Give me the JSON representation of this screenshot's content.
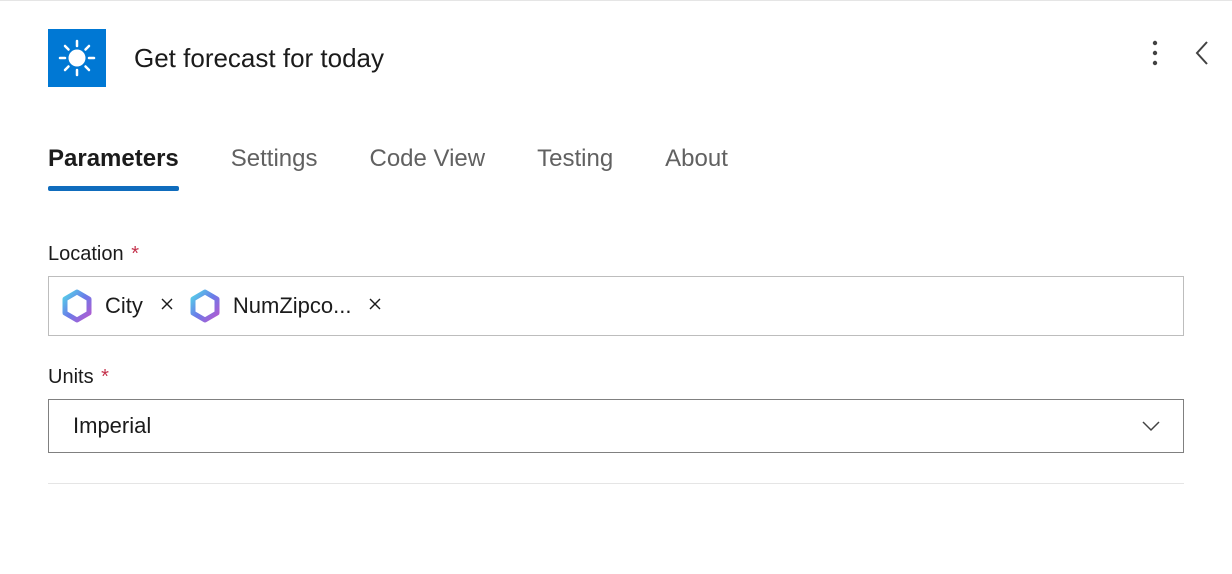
{
  "header": {
    "title": "Get forecast for today",
    "icon": "sun-icon"
  },
  "tabs": [
    {
      "label": "Parameters",
      "active": true
    },
    {
      "label": "Settings",
      "active": false
    },
    {
      "label": "Code View",
      "active": false
    },
    {
      "label": "Testing",
      "active": false
    },
    {
      "label": "About",
      "active": false
    }
  ],
  "fields": {
    "location": {
      "label": "Location",
      "required": true,
      "tokens": [
        {
          "label": "City"
        },
        {
          "label": "NumZipco..."
        }
      ]
    },
    "units": {
      "label": "Units",
      "required": true,
      "value": "Imperial"
    }
  },
  "icons": {
    "required": "*"
  }
}
